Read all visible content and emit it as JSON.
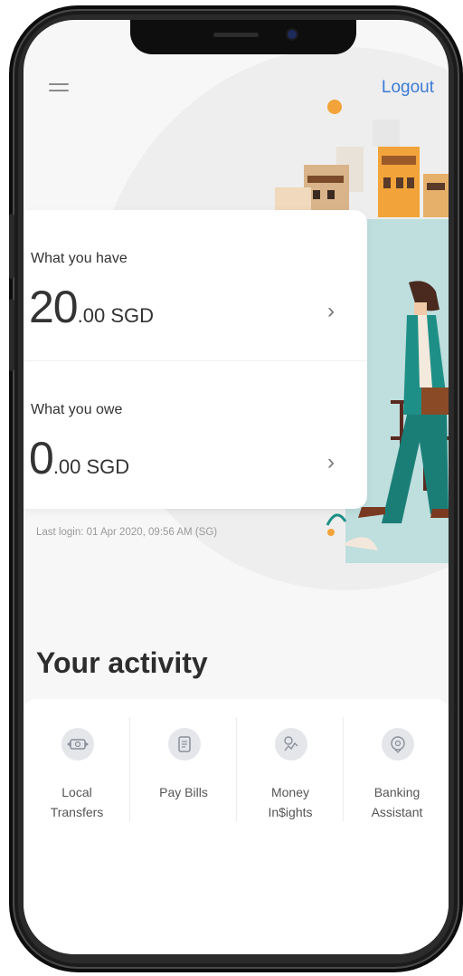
{
  "header": {
    "logout_label": "Logout"
  },
  "balances": {
    "have": {
      "label": "What you have",
      "amount_int": "20",
      "amount_dec": ".00 SGD"
    },
    "owe": {
      "label": "What you owe",
      "amount_int": "0",
      "amount_dec": ".00 SGD"
    },
    "chevron": "›"
  },
  "last_login": "Last login: 01 Apr 2020, 09:56 AM (SG)",
  "activity": {
    "title": "Your activity",
    "items": [
      {
        "line1": "Local",
        "line2": "Transfers",
        "icon": "transfer-icon"
      },
      {
        "line1": "Pay Bills",
        "line2": "",
        "icon": "bill-icon"
      },
      {
        "line1": "Money",
        "line2": "In$ights",
        "icon": "insights-icon"
      },
      {
        "line1": "Banking",
        "line2": "Assistant",
        "icon": "assistant-icon"
      }
    ]
  },
  "colors": {
    "link": "#3b7bd4",
    "teal": "#1e8f86",
    "accent_orange": "#f2a33a",
    "text": "#333333"
  }
}
